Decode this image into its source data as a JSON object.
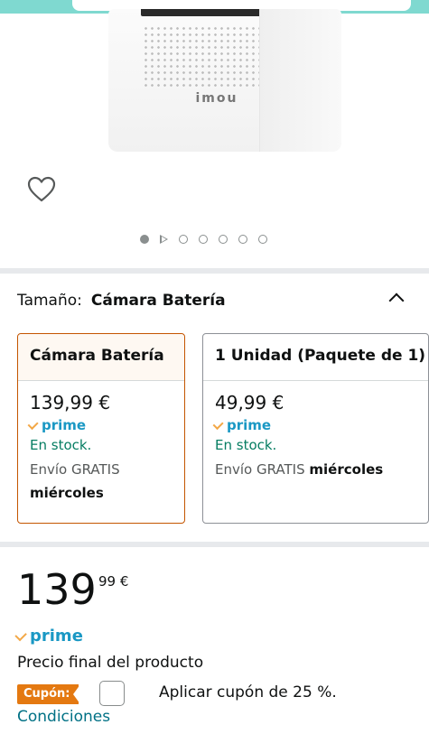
{
  "product_image": {
    "brand": "imou"
  },
  "gallery": {
    "dots_count": 7,
    "active_index": 0
  },
  "size_selector": {
    "label": "Tamaño:",
    "selected": "Cámara Batería"
  },
  "options": [
    {
      "title": "Cámara Batería",
      "price": "139,99 €",
      "prime": "prime",
      "stock": "En stock.",
      "shipping": "Envío GRATIS",
      "shipping_day": "miércoles",
      "selected": true
    },
    {
      "title": "1 Unidad (Paquete de 1)",
      "price": "49,99 €",
      "prime": "prime",
      "stock": "En stock.",
      "shipping": "Envío GRATIS",
      "shipping_day": "miércoles",
      "selected": false
    }
  ],
  "price": {
    "integer": "139",
    "fraction_currency": "99 €"
  },
  "prime_label": "prime",
  "final_price_text": "Precio final del producto",
  "coupon": {
    "badge": "Cupón:",
    "text": "Aplicar cupón de 25 %.",
    "checked": false
  },
  "conditions_link": "Condiciones",
  "colors": {
    "accent_orange": "#c45500",
    "stock_green": "#067d62",
    "link_teal": "#007185",
    "prime_blue": "#1a98c4",
    "coupon_orange": "#e47911"
  },
  "icons": [
    "heart-icon",
    "play-icon",
    "chevron-up-icon",
    "prime-check-icon"
  ]
}
